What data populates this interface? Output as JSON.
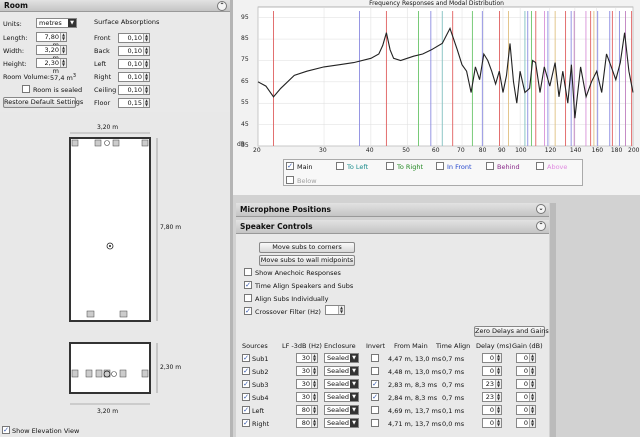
{
  "room": {
    "title": "Room",
    "units_label": "Units:",
    "units_value": "metres",
    "length_label": "Length:",
    "length_value": "7,80 m",
    "width_label": "Width:",
    "width_value": "3,20 m",
    "height_label": "Height:",
    "height_value": "2,30 m",
    "volume_label": "Room Volume:",
    "volume_value": "57,4 m",
    "volume_sup": "3",
    "sealed_label": "Room is sealed",
    "restore_label": "Restore Default Settings",
    "absorptions_title": "Surface Absorptions",
    "surfaces": [
      {
        "label": "Front",
        "value": "0,10"
      },
      {
        "label": "Back",
        "value": "0,10"
      },
      {
        "label": "Left",
        "value": "0,10"
      },
      {
        "label": "Right",
        "value": "0,10"
      },
      {
        "label": "Ceiling",
        "value": "0,10"
      },
      {
        "label": "Floor",
        "value": "0,15"
      }
    ]
  },
  "plan": {
    "top_width": "3,20 m",
    "length": "7,80 m",
    "bottom_width": "3,20 m",
    "elev_height": "2,30 m",
    "elev_width": "3,20 m",
    "show_elevation_label": "Show Elevation View"
  },
  "chart": {
    "title": "Frequency Responses and Modal Distribution",
    "y_unit": "dB",
    "y_ticks": [
      "95",
      "85",
      "75",
      "65",
      "55",
      "45",
      "35"
    ],
    "x_ticks": [
      "20",
      "30",
      "40",
      "50",
      "60",
      "70",
      "80",
      "90",
      "100",
      "120",
      "140",
      "160",
      "180",
      "200"
    ],
    "legend": [
      {
        "label": "Main",
        "color": "#111111",
        "checked": true
      },
      {
        "label": "To Left",
        "color": "#1a8c8c",
        "checked": false
      },
      {
        "label": "To Right",
        "color": "#228822",
        "checked": false
      },
      {
        "label": "In Front",
        "color": "#2244cc",
        "checked": false
      },
      {
        "label": "Behind",
        "color": "#8a2a8a",
        "checked": false
      },
      {
        "label": "Above",
        "color": "#e08ae0",
        "checked": false
      },
      {
        "label": "Below",
        "color": "#a0a0a0",
        "checked": false
      }
    ]
  },
  "chart_data": {
    "type": "line",
    "title": "Frequency Responses and Modal Distribution",
    "ylabel": "dB",
    "xscale": "log",
    "xlim": [
      20,
      200
    ],
    "ylim": [
      35,
      100
    ],
    "series": [
      {
        "name": "Main",
        "x": [
          20,
          21,
          22,
          23,
          25,
          27,
          30,
          33,
          36,
          40,
          42,
          43,
          44,
          45,
          46,
          48,
          50,
          52,
          55,
          58,
          62,
          65,
          68,
          70,
          72,
          74,
          76,
          78,
          80,
          82,
          84,
          86,
          88,
          90,
          92,
          94,
          96,
          98,
          100,
          103,
          106,
          108,
          110,
          113,
          116,
          120,
          124,
          127,
          130,
          134,
          137,
          140,
          145,
          150,
          155,
          160,
          165,
          170,
          175,
          180,
          185,
          190,
          195,
          200
        ],
        "values": [
          65,
          63,
          58,
          62,
          68,
          70,
          72,
          73,
          74,
          76,
          78,
          82,
          88,
          80,
          76,
          75,
          76,
          77,
          78,
          80,
          83,
          90,
          80,
          73,
          70,
          60,
          72,
          66,
          78,
          75,
          70,
          64,
          70,
          60,
          68,
          83,
          65,
          55,
          70,
          60,
          62,
          75,
          74,
          60,
          72,
          63,
          74,
          58,
          70,
          55,
          73,
          48,
          72,
          58,
          65,
          70,
          60,
          78,
          72,
          66,
          74,
          88,
          70,
          60
        ]
      }
    ],
    "modes_hz": [
      22.0,
      44.0,
      66.1,
      88.1,
      110.1,
      132.2,
      154.2,
      176.2,
      198.3,
      53.6,
      74.6,
      107.2,
      37.3,
      57.8,
      79.3,
      104.8,
      118.6,
      136.8,
      161.0,
      173.4,
      184.0,
      116.2,
      149.8,
      93.1,
      124.0,
      157.3,
      62.0,
      103.0,
      139.4,
      191.0
    ]
  },
  "microphone": {
    "title": "Microphone Positions"
  },
  "speakers": {
    "title": "Speaker Controls",
    "move_corners": "Move subs to corners",
    "move_walls": "Move subs to wall midpoints",
    "show_anechoic": "Show Anechoic Responses",
    "time_align": "Time Align Speakers and Subs",
    "align_individually": "Align Subs Individually",
    "crossover": "Crossover Filter (Hz)",
    "zero_delays": "Zero Delays and Gains",
    "headers": [
      "Sources",
      "LF -3dB (Hz)",
      "Enclosure",
      "Invert",
      "From Main",
      "Time Align",
      "Delay (ms)",
      "Gain (dB)"
    ],
    "rows": [
      {
        "name": "Sub1",
        "lf": "30",
        "enc": "Sealed",
        "invert": false,
        "from": "4,47 m, 13,0 ms",
        "align": "0,7 ms",
        "delay": "0",
        "gain": "0"
      },
      {
        "name": "Sub2",
        "lf": "30",
        "enc": "Sealed",
        "invert": false,
        "from": "4,48 m, 13,0 ms",
        "align": "0,7 ms",
        "delay": "0",
        "gain": "0"
      },
      {
        "name": "Sub3",
        "lf": "30",
        "enc": "Sealed",
        "invert": true,
        "from": "2,83 m, 8,3 ms",
        "align": "0,7 ms",
        "delay": "23",
        "gain": "0"
      },
      {
        "name": "Sub4",
        "lf": "30",
        "enc": "Sealed",
        "invert": true,
        "from": "2,84 m, 8,3 ms",
        "align": "0,7 ms",
        "delay": "23",
        "gain": "0"
      },
      {
        "name": "Left",
        "lf": "80",
        "enc": "Sealed",
        "invert": false,
        "from": "4,69 m, 13,7 ms",
        "align": "0,1 ms",
        "delay": "0",
        "gain": "0"
      },
      {
        "name": "Right",
        "lf": "80",
        "enc": "Sealed",
        "invert": false,
        "from": "4,71 m, 13,7 ms",
        "align": "0,0 ms",
        "delay": "0",
        "gain": "0"
      }
    ]
  }
}
